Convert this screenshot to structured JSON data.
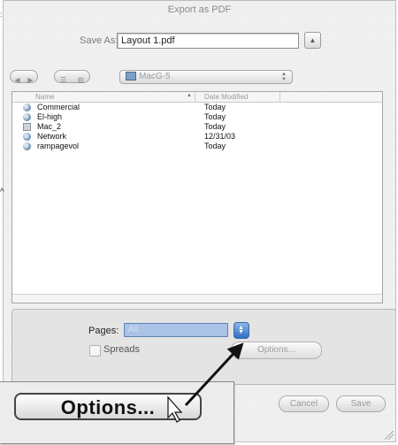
{
  "window": {
    "title": "Export as PDF"
  },
  "save_as": {
    "label": "Save As:",
    "value": "Layout 1.pdf",
    "collapse_icon": "triangle-up-icon"
  },
  "nav": {
    "back_icon": "arrow-left-icon",
    "forward_icon": "arrow-right-icon",
    "list_view_icon": "list-view-icon",
    "column_view_icon": "column-view-icon",
    "location": "MacG-5",
    "location_icon": "hard-disk-icon"
  },
  "browser": {
    "columns": {
      "name": "Name",
      "date": "Date Modified"
    },
    "files": [
      {
        "name": "Commercial",
        "date": "Today",
        "icon": "network-volume-icon"
      },
      {
        "name": "El-high",
        "date": "Today",
        "icon": "network-volume-icon"
      },
      {
        "name": "Mac_2",
        "date": "Today",
        "icon": "disk-icon"
      },
      {
        "name": "Network",
        "date": "12/31/03",
        "icon": "network-globe-icon"
      },
      {
        "name": "rampagevol",
        "date": "Today",
        "icon": "network-volume-icon"
      }
    ]
  },
  "options_panel": {
    "pages_label": "Pages:",
    "pages_value": "All",
    "spreads_label": "Spreads",
    "options_button": "Options..."
  },
  "buttons": {
    "cancel": "Cancel",
    "save": "Save"
  },
  "callout": {
    "options_label": "Options..."
  },
  "colors": {
    "accent": "#2f6dc4",
    "selection": "#a9c2e6"
  }
}
